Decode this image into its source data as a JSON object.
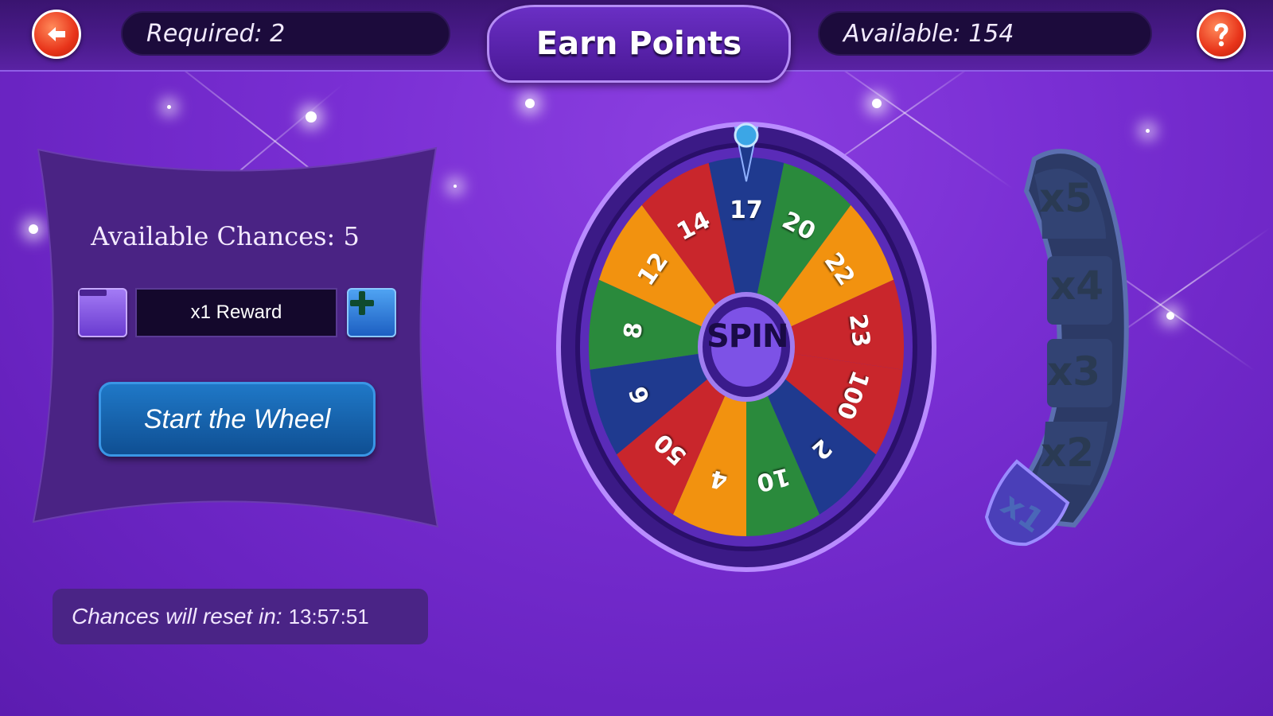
{
  "header": {
    "back_icon": "back-arrow-icon",
    "required_text": "Required: 2",
    "title": "Earn Points",
    "available_text": "Available: 154",
    "help_icon": "question-mark-icon"
  },
  "panel": {
    "chances_text": "Available Chances: 5",
    "decrease_icon": "minus-icon",
    "reward_value": "x1 Reward",
    "increase_icon": "plus-icon",
    "start_button": "Start the Wheel"
  },
  "reset": {
    "label": "Chances will reset in:",
    "time": "13:57:51"
  },
  "wheel": {
    "center_label": "SPIN",
    "segments": [
      {
        "value": "17",
        "color": "#1f3a8f"
      },
      {
        "value": "20",
        "color": "#2a8a3c"
      },
      {
        "value": "22",
        "color": "#f2920f"
      },
      {
        "value": "23",
        "color": "#c9262c"
      },
      {
        "value": "100",
        "color": "#c9262c"
      },
      {
        "value": "2",
        "color": "#1f3a8f"
      },
      {
        "value": "10",
        "color": "#2a8a3c"
      },
      {
        "value": "4",
        "color": "#f2920f"
      },
      {
        "value": "50",
        "color": "#c9262c"
      },
      {
        "value": "6",
        "color": "#1f3a8f"
      },
      {
        "value": "8",
        "color": "#2a8a3c"
      },
      {
        "value": "12",
        "color": "#f2920f"
      },
      {
        "value": "14",
        "color": "#c9262c"
      }
    ]
  },
  "multiplier": {
    "levels": [
      "x5",
      "x4",
      "x3",
      "x2",
      "x1"
    ],
    "active": "x1"
  }
}
